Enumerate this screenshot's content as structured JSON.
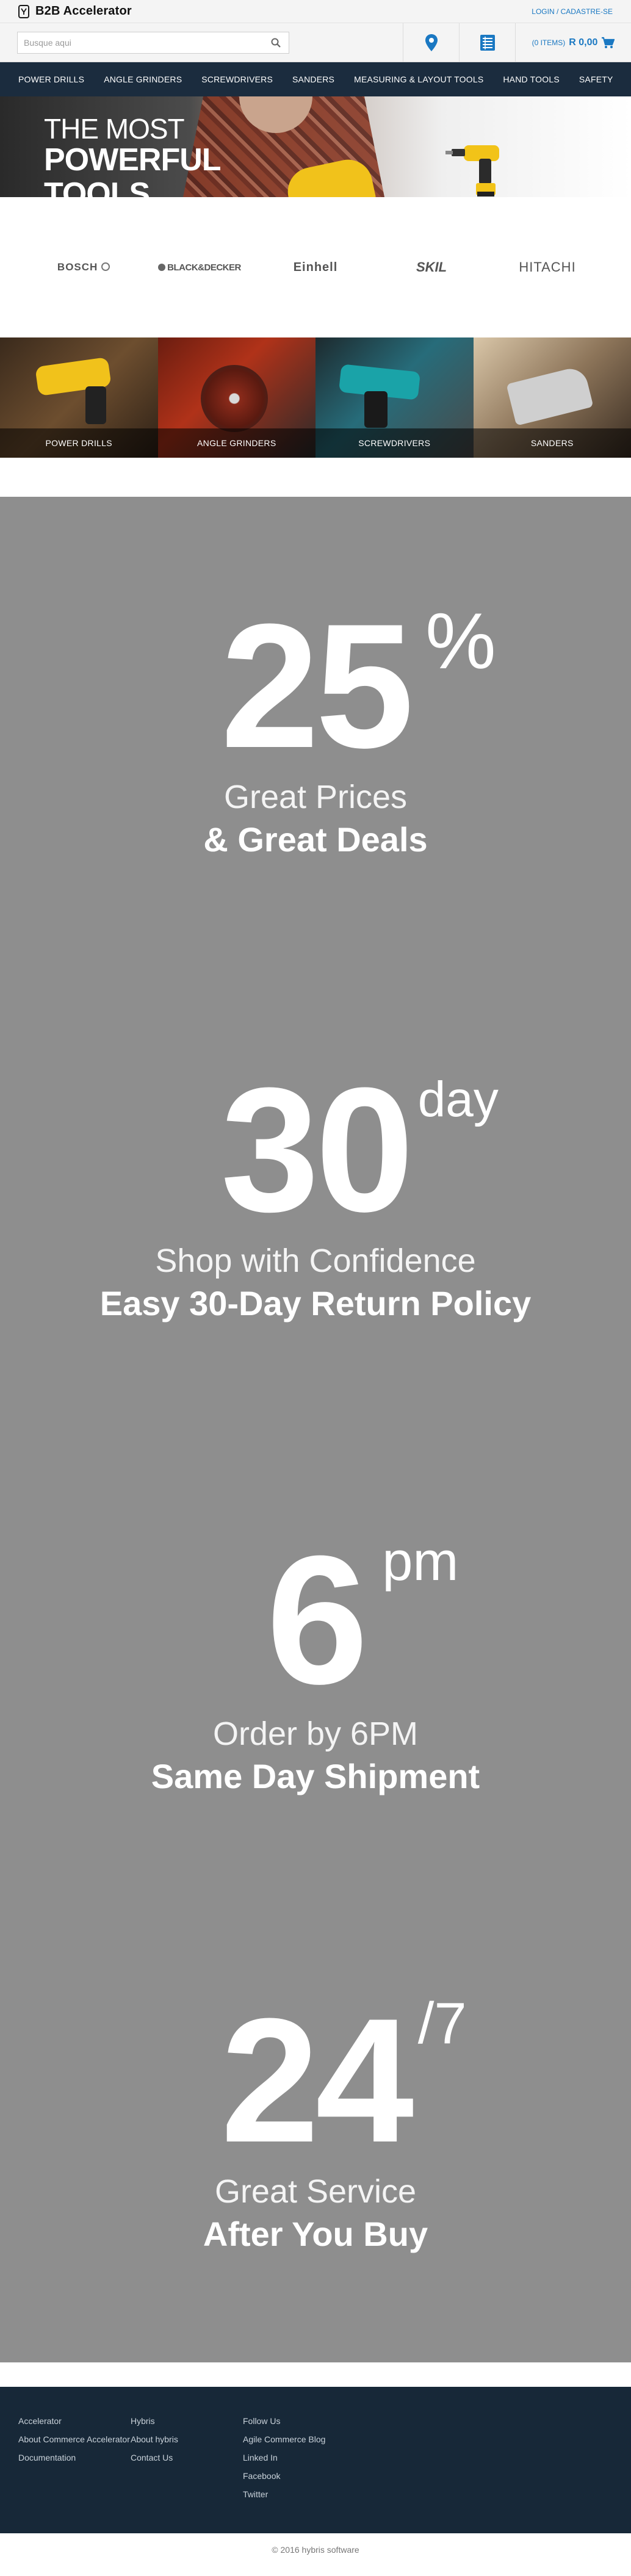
{
  "header": {
    "brand": "B2B Accelerator",
    "login": "LOGIN / CADASTRE-SE"
  },
  "search": {
    "placeholder": "Busque aqui"
  },
  "cart": {
    "items": "(0 ITEMS)",
    "total": "R 0,00"
  },
  "nav": {
    "items": [
      "POWER DRILLS",
      "ANGLE GRINDERS",
      "SCREWDRIVERS",
      "SANDERS",
      "MEASURING & LAYOUT TOOLS",
      "HAND TOOLS",
      "SAFETY"
    ]
  },
  "hero": {
    "line1": "THE MOST",
    "line2": "POWERFUL",
    "line3": "TOOLS"
  },
  "brands": [
    "BOSCH",
    "BLACK&DECKER",
    "Einhell",
    "SKIL",
    "HITACHI"
  ],
  "categories": [
    "POWER DRILLS",
    "ANGLE GRINDERS",
    "SCREWDRIVERS",
    "SANDERS"
  ],
  "promos": [
    {
      "big": "25",
      "sup": "%",
      "line1": "Great Prices",
      "line2": "& Great Deals"
    },
    {
      "big": "30",
      "sup": "day",
      "line1": "Shop with Confidence",
      "line2": "Easy 30-Day Return Policy"
    },
    {
      "big": "6",
      "sup": "pm",
      "line1": "Order by 6PM",
      "line2": "Same Day Shipment"
    },
    {
      "big": "24",
      "sup": "/7",
      "line1": "Great Service",
      "line2": "After You Buy"
    }
  ],
  "footer": {
    "col1": [
      "Accelerator",
      "About Commerce Accelerator",
      "Documentation"
    ],
    "col2": [
      "Hybris",
      "About hybris",
      "Contact Us"
    ],
    "col3": [
      "Follow Us",
      "Agile Commerce Blog",
      "Linked In",
      "Facebook",
      "Twitter"
    ],
    "copyright": "© 2016 hybris software"
  },
  "colors": {
    "nav_bg": "#1b2c3e",
    "accent": "#1a78c2",
    "promo_bg": "#8e8e8e",
    "footer_bg": "#172838"
  }
}
